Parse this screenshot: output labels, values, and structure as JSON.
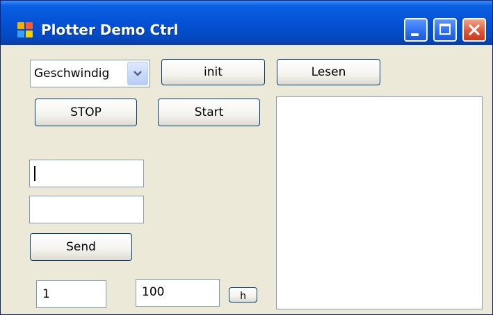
{
  "window": {
    "title": "Plotter Demo Ctrl",
    "controls": {
      "minimize_icon": "minimize-icon",
      "maximize_icon": "maximize-icon",
      "close_icon": "close-icon"
    }
  },
  "combo": {
    "value": "Geschwindig"
  },
  "buttons": {
    "init": "init",
    "lesen": "Lesen",
    "stop": "STOP",
    "start": "Start",
    "send": "Send",
    "small": "h"
  },
  "fields": {
    "input1": "",
    "input2": "",
    "field_left": "1",
    "field_right": "100"
  },
  "colors": {
    "titlebar": "#0452d6",
    "window_bg": "#ece9d8",
    "close_button": "#e0583a"
  }
}
